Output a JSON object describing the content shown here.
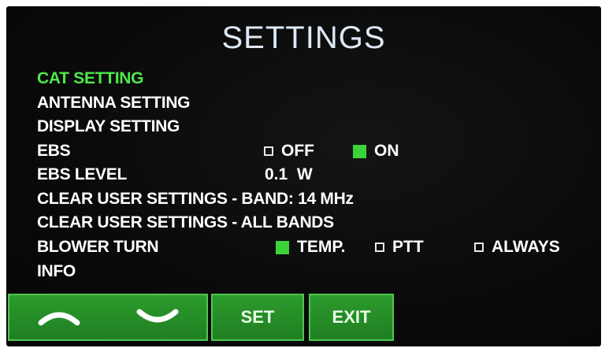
{
  "title": "SETTINGS",
  "menu": {
    "items": [
      {
        "label": "CAT SETTING"
      },
      {
        "label": "ANTENNA SETTING"
      },
      {
        "label": "DISPLAY SETTING"
      },
      {
        "label": "EBS"
      },
      {
        "label": "EBS LEVEL"
      },
      {
        "label": "CLEAR USER SETTINGS - BAND: 14 MHz"
      },
      {
        "label": "CLEAR USER SETTINGS - ALL BANDS"
      },
      {
        "label": "BLOWER TURN"
      },
      {
        "label": "INFO"
      }
    ]
  },
  "ebs": {
    "off_label": "OFF",
    "on_label": "ON",
    "selected": "ON"
  },
  "ebs_level": {
    "value": "0.1",
    "unit": "W"
  },
  "blower": {
    "options": [
      {
        "label": "TEMP.",
        "checked": true
      },
      {
        "label": "PTT",
        "checked": false
      },
      {
        "label": "ALWAYS",
        "checked": false
      }
    ]
  },
  "buttons": {
    "up_icon": "chevron-up-icon",
    "down_icon": "chevron-down-icon",
    "set_label": "SET",
    "exit_label": "EXIT"
  },
  "colors": {
    "active_item": "#4ee84a",
    "button_green": "#2c9b2c",
    "checkbox_checked": "#3ad43a",
    "title": "#dfe9f6"
  }
}
